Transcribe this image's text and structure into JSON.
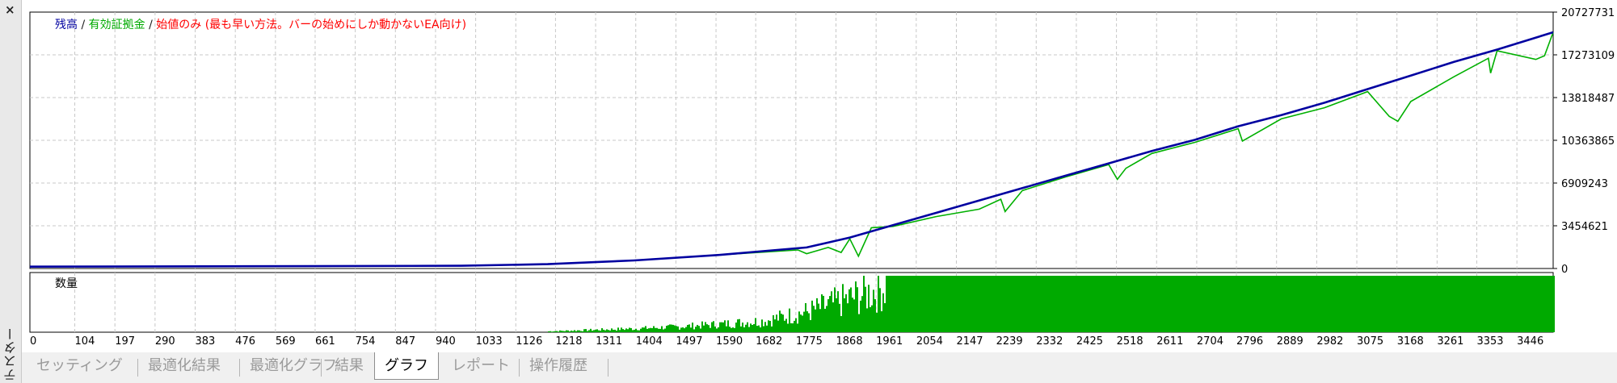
{
  "window": {
    "close_label": "×",
    "panel_title": "テスター"
  },
  "legend": {
    "balance": "残高",
    "equity": "有効証拠金",
    "mode": "始値のみ (最も早い方法。バーの始めにしか動かないEA向け)",
    "separator": "/"
  },
  "volume_label": "数量",
  "colors": {
    "balance": "#0000a0",
    "equity": "#00b000",
    "mode": "#ff0000",
    "volume": "#00aa00",
    "grid": "#c8c8c8"
  },
  "chart_data": [
    {
      "type": "line",
      "title": "",
      "ylim": [
        0,
        20727731
      ],
      "y_ticks": [
        "20727731",
        "17273109",
        "13818487",
        "10363865",
        "6909243",
        "3454621",
        "0"
      ],
      "x_ticks": [
        "0",
        "104",
        "197",
        "290",
        "383",
        "476",
        "569",
        "661",
        "754",
        "847",
        "940",
        "1033",
        "1126",
        "1218",
        "1311",
        "1404",
        "1497",
        "1590",
        "1682",
        "1775",
        "1868",
        "1961",
        "2054",
        "2147",
        "2239",
        "2332",
        "2425",
        "2518",
        "2611",
        "2704",
        "2796",
        "2889",
        "2982",
        "3075",
        "3168",
        "3261",
        "3353",
        "3446"
      ],
      "xlim": [
        0,
        3530
      ],
      "grid": true,
      "series": [
        {
          "name": "残高",
          "x": [
            0,
            500,
            1000,
            1200,
            1400,
            1600,
            1800,
            1900,
            2000,
            2100,
            2200,
            2300,
            2400,
            2500,
            2600,
            2700,
            2800,
            2900,
            3000,
            3100,
            3200,
            3300,
            3400,
            3530
          ],
          "y": [
            150000,
            180000,
            220000,
            350000,
            650000,
            1100000,
            1700000,
            2500000,
            3500000,
            4500000,
            5500000,
            6500000,
            7500000,
            8500000,
            9500000,
            10400000,
            11500000,
            12400000,
            13400000,
            14500000,
            15600000,
            16700000,
            17700000,
            19100000
          ]
        },
        {
          "name": "有効証拠金",
          "x": [
            0,
            500,
            1000,
            1200,
            1400,
            1600,
            1780,
            1800,
            1850,
            1880,
            1900,
            1920,
            1950,
            2000,
            2100,
            2200,
            2250,
            2260,
            2300,
            2400,
            2500,
            2520,
            2540,
            2600,
            2700,
            2800,
            2810,
            2900,
            3000,
            3100,
            3150,
            3170,
            3200,
            3300,
            3380,
            3385,
            3400,
            3490,
            3510,
            3530
          ],
          "y": [
            150000,
            180000,
            220000,
            350000,
            650000,
            1100000,
            1500000,
            1200000,
            1700000,
            1300000,
            2400000,
            1000000,
            3300000,
            3400000,
            4200000,
            4800000,
            5600000,
            4600000,
            6300000,
            7400000,
            8400000,
            7200000,
            8100000,
            9300000,
            10200000,
            11300000,
            10300000,
            12100000,
            13000000,
            14300000,
            12300000,
            11900000,
            13500000,
            15500000,
            17000000,
            15800000,
            17600000,
            16900000,
            17200000,
            19100000
          ]
        }
      ]
    },
    {
      "type": "bar",
      "title": "数量",
      "xlim": [
        0,
        3530
      ],
      "series": [
        {
          "name": "数量",
          "x": [
            1200,
            1300,
            1400,
            1500,
            1600,
            1700,
            1750,
            1800,
            1850,
            1900,
            1950,
            1980,
            3530
          ],
          "y": [
            0.02,
            0.05,
            0.08,
            0.12,
            0.18,
            0.25,
            0.35,
            0.45,
            0.6,
            0.75,
            0.9,
            1.0,
            1.0
          ]
        }
      ]
    }
  ],
  "tabs": [
    {
      "label": "セッティング",
      "active": false
    },
    {
      "label": "最適化結果",
      "active": false
    },
    {
      "label": "最適化グラフ",
      "active": false
    },
    {
      "label": "結果",
      "active": false
    },
    {
      "label": "グラフ",
      "active": true
    },
    {
      "label": "レポート",
      "active": false
    },
    {
      "label": "操作履歴",
      "active": false
    }
  ]
}
